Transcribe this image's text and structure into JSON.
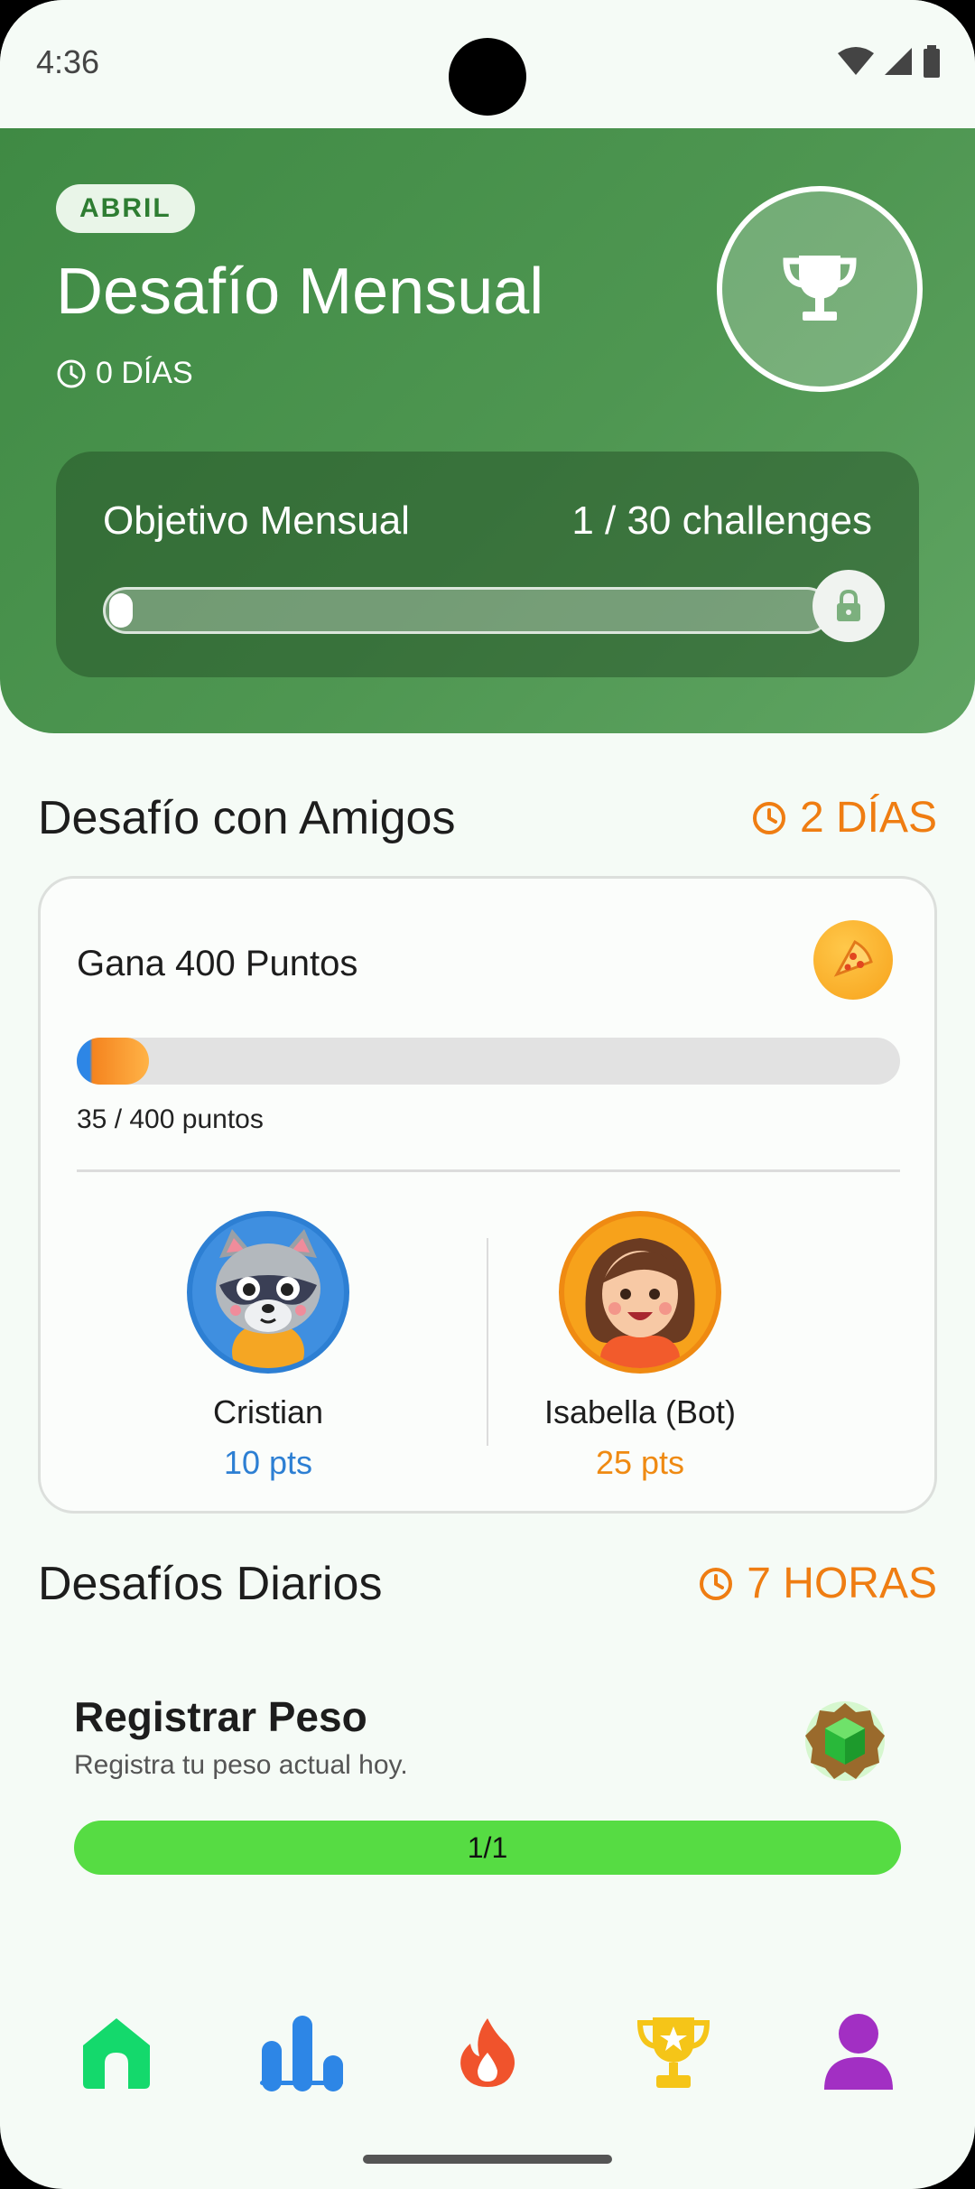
{
  "status_bar": {
    "time": "4:36"
  },
  "monthly": {
    "badge": "ABRIL",
    "title": "Desafío Mensual",
    "days_left": "0 DÍAS",
    "goal_label": "Objetivo Mensual",
    "goal_value": "1 / 30 challenges",
    "progress_fraction": 0.033
  },
  "friends": {
    "section_title": "Desafío con Amigos",
    "timer": "2 DÍAS",
    "challenge_title": "Gana 400 Puntos",
    "points_text": "35 / 400 puntos",
    "progress_fraction": 0.0875,
    "players": [
      {
        "name": "Cristian",
        "points": "10 pts",
        "color": "#2d7fd3"
      },
      {
        "name": "Isabella (Bot)",
        "points": "25 pts",
        "color": "#ef8a12"
      }
    ]
  },
  "daily": {
    "section_title": "Desafíos Diarios",
    "timer": "7 HORAS",
    "task_title": "Registrar Peso",
    "task_desc": "Registra tu peso actual hoy.",
    "progress_text": "1/1",
    "progress_fraction": 1.0
  },
  "nav": {
    "items": [
      "home-icon",
      "stats-icon",
      "flame-icon",
      "trophy-icon",
      "profile-icon"
    ],
    "active": "stats-icon"
  },
  "colors": {
    "accent_green": "#4e9651",
    "timer_orange": "#ef7d12",
    "progress_green": "#56dc43",
    "nav_blue": "#2d86e6"
  }
}
